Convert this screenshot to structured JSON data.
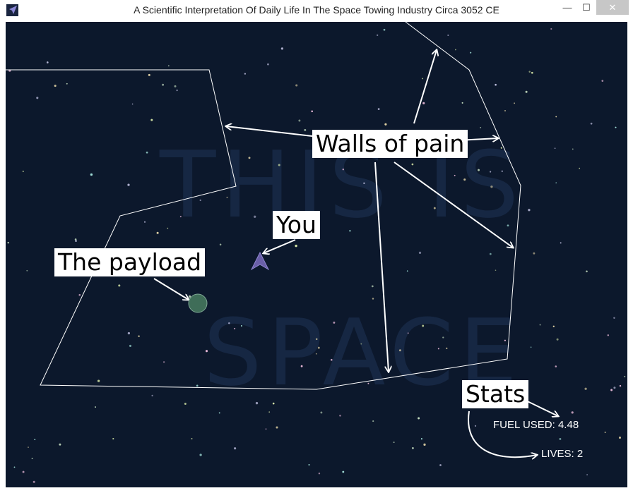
{
  "window": {
    "title": "A Scientific Interpretation Of Daily Life In The Space Towing Industry Circa 3052 CE",
    "buttons": {
      "minimize": "—",
      "maximize": "☐",
      "close": "✕"
    }
  },
  "background_text": {
    "line1": "THIS IS",
    "line2": "SPACE"
  },
  "annotations": {
    "walls": "Walls of pain",
    "you": "You",
    "payload": "The payload",
    "stats": "Stats"
  },
  "hud": {
    "fuel_label": "FUEL USED: 4.48",
    "lives_label": "LIVES: 2"
  },
  "colors": {
    "space": "#0c182c",
    "wall": "#ffffff",
    "ship": "#6a5fa8",
    "payload": "#3f6d58"
  }
}
